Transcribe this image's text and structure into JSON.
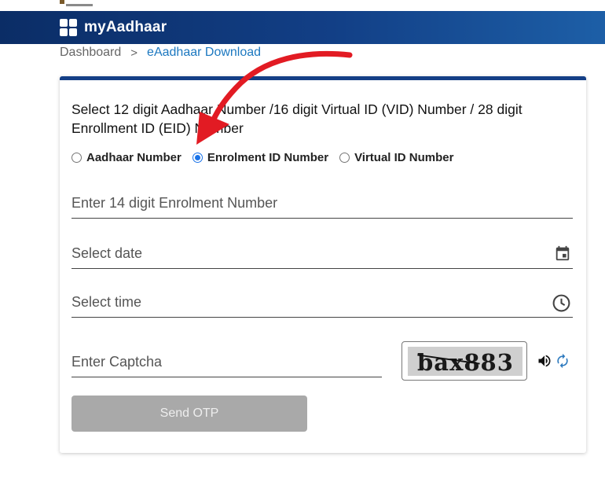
{
  "header": {
    "app_title": "myAadhaar"
  },
  "breadcrumb": {
    "home": "Dashboard",
    "separator": ">",
    "current": "eAadhaar Download"
  },
  "form": {
    "instruction": "Select 12 digit Aadhaar Number /16 digit Virtual ID (VID) Number / 28 digit Enrollment ID (EID) Number",
    "id_type_options": [
      {
        "label": "Aadhaar Number",
        "selected": false
      },
      {
        "label": "Enrolment ID Number",
        "selected": true
      },
      {
        "label": "Virtual ID Number",
        "selected": false
      }
    ],
    "enrolment_placeholder": "Enter 14 digit Enrolment Number",
    "date_placeholder": "Select date",
    "time_placeholder": "Select time",
    "captcha_placeholder": "Enter Captcha",
    "captcha_text": "bax883",
    "send_otp_label": "Send OTP"
  },
  "colors": {
    "header_start": "#0b2d66",
    "header_end": "#1d5fa7",
    "link": "#1c78c0",
    "radio_selected": "#1a73e8",
    "button_disabled": "#a9a9a9",
    "annotation_arrow": "#e21b23"
  },
  "icons": {
    "logo": "grid-logo-icon",
    "date": "calendar-icon",
    "time": "clock-icon",
    "audio": "speaker-icon",
    "refresh": "refresh-icon"
  }
}
